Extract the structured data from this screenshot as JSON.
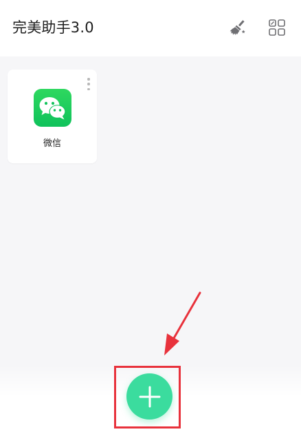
{
  "header": {
    "title": "完美助手3.0",
    "clean_icon": "broom-icon",
    "layout_icon": "grid-layout-icon"
  },
  "apps": [
    {
      "name": "微信",
      "icon": "wechat-icon",
      "icon_color": "#1AC75D",
      "menu_icon": "more-vertical-icon"
    }
  ],
  "fab": {
    "icon": "plus-icon",
    "color": "#3BDC9E"
  },
  "annotation": {
    "color": "#E8323C",
    "highlight_target": "add-button"
  }
}
